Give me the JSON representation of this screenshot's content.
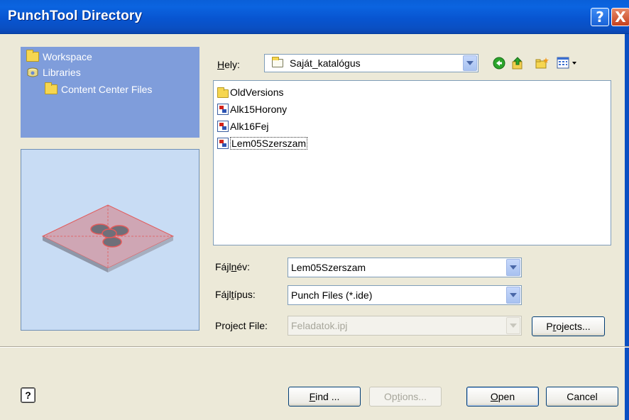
{
  "window": {
    "title": "PunchTool Directory",
    "help_button": "?",
    "close_button": "X"
  },
  "places": {
    "items": [
      {
        "label": "Workspace",
        "icon": "folder-icon"
      },
      {
        "label": "Libraries",
        "icon": "libraries-icon"
      },
      {
        "label": "Content Center Files",
        "icon": "folder-icon"
      }
    ]
  },
  "location": {
    "label_pre": "",
    "label_underline": "H",
    "label_post": "ely:",
    "value": "Saját_katalógus"
  },
  "toolbar": {
    "icons": [
      "back-icon",
      "up-folder-icon",
      "new-folder-icon",
      "views-menu-icon"
    ]
  },
  "files": [
    {
      "name": "OldVersions",
      "type": "folder"
    },
    {
      "name": "Alk15Horony",
      "type": "punch-file"
    },
    {
      "name": "Alk16Fej",
      "type": "punch-file"
    },
    {
      "name": "Lem05Szerszam",
      "type": "punch-file",
      "selected": true
    }
  ],
  "filename": {
    "label_pre": "Fájl",
    "label_underline": "n",
    "label_post": "év:",
    "value": "Lem05Szerszam"
  },
  "filetype": {
    "label_pre": "Fájl",
    "label_underline": "t",
    "label_post": "ípus:",
    "value": "Punch Files (*.ide)"
  },
  "project_file": {
    "label": "Project File:",
    "value": "Feladatok.ipj",
    "button_pre": "P",
    "button_underline": "r",
    "button_post": "ojects..."
  },
  "buttons": {
    "find_underline": "F",
    "find_post": "ind ...",
    "options_pre": "Op",
    "options_underline": "t",
    "options_post": "ions...",
    "open_underline": "O",
    "open_post": "pen",
    "cancel": "Cancel",
    "help": "?"
  },
  "colors": {
    "title_bar": "#0a5fd8",
    "places_bg": "#7f9ddb",
    "preview_bg": "#c8dcf4",
    "dialog_bg": "#ece9d8"
  }
}
